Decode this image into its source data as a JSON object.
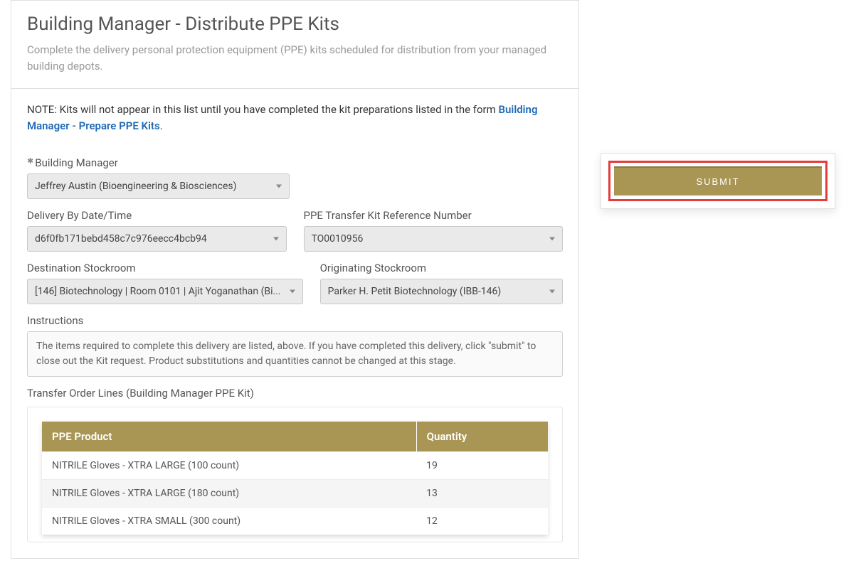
{
  "header": {
    "title": "Building Manager - Distribute PPE Kits",
    "subtitle": "Complete the delivery personal protection equipment (PPE) kits scheduled for distribution from your managed building depots."
  },
  "note": {
    "prefix": "NOTE: Kits will not appear in this list until you have completed the kit preparations listed in the form ",
    "link_text": "Building Manager - Prepare PPE Kits",
    "suffix": "."
  },
  "form": {
    "building_manager": {
      "label": "Building Manager",
      "value": "Jeffrey Austin (Bioengineering & Biosciences)"
    },
    "delivery_by": {
      "label": "Delivery By Date/Time",
      "value": "d6f0fb171bebd458c7c976eecc4bcb94"
    },
    "kit_ref": {
      "label": "PPE Transfer Kit Reference Number",
      "value": "TO0010956"
    },
    "dest_stockroom": {
      "label": "Destination Stockroom",
      "value": "[146] Biotechnology | Room 0101 | Ajit Yoganathan (Bi..."
    },
    "orig_stockroom": {
      "label": "Originating Stockroom",
      "value": "Parker H. Petit Biotechnology (IBB-146)"
    },
    "instructions": {
      "label": "Instructions",
      "text": "The items required to complete this delivery are listed, above.  If you have completed this delivery, click \"submit\" to close out the Kit request.  Product substitutions and quantities cannot be changed at this stage."
    },
    "transfer_label": "Transfer Order Lines (Building Manager PPE Kit)"
  },
  "table": {
    "headers": {
      "product": "PPE Product",
      "quantity": "Quantity"
    },
    "rows": [
      {
        "product": "NITRILE Gloves - XTRA LARGE (100 count)",
        "quantity": "19"
      },
      {
        "product": "NITRILE Gloves - XTRA LARGE (180 count)",
        "quantity": "13"
      },
      {
        "product": "NITRILE Gloves - XTRA SMALL (300 count)",
        "quantity": "12"
      }
    ]
  },
  "sidebar": {
    "submit_label": "SUBMIT"
  }
}
